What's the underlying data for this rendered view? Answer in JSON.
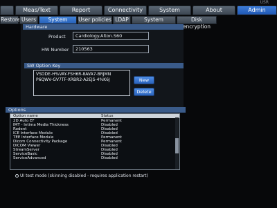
{
  "header": {
    "user": "USR"
  },
  "main_tabs": [
    "Meas/Text",
    "Report",
    "Connectivity",
    "System",
    "About",
    "Admin"
  ],
  "sub_tabs": [
    "Restore",
    "Users",
    "System Admin",
    "User policies",
    "LDAP",
    "System password",
    "Disk encryption"
  ],
  "hardware": {
    "title": "Hardware",
    "product_label": "Product",
    "product_value": "Cardiology.Alton.S60",
    "hw_number_label": "HW Number",
    "hw_number_value": "210563"
  },
  "sw_option_key": {
    "title": "SW Option Key",
    "lines": [
      "VSDDE-H%VAY-FSH6R-8AVA7-BRJMN",
      "P6QWV-GV7TF-XRBR2-A2EJS-4%K6J"
    ],
    "new_label": "New",
    "delete_label": "Delete"
  },
  "options": {
    "title": "Options",
    "col_name": "Option name",
    "col_status": "Status",
    "rows": [
      {
        "name": "2D Auto EF",
        "status": "Permanent"
      },
      {
        "name": "IMT - Intima Media Thickness",
        "status": "Disabled"
      },
      {
        "name": "Rodent",
        "status": "Disabled"
      },
      {
        "name": "ICE Interface Module",
        "status": "Disabled"
      },
      {
        "name": "TEE Interface Module",
        "status": "Permanent"
      },
      {
        "name": "Dicom Connectivity Package",
        "status": "Permanent"
      },
      {
        "name": "DICOM Viewer",
        "status": "Disabled"
      },
      {
        "name": "StreamServer",
        "status": "Disabled"
      },
      {
        "name": "ServiceBasic",
        "status": "Disabled"
      },
      {
        "name": "ServiceAdvanced",
        "status": "Disabled"
      }
    ]
  },
  "ui_test_mode_label": "UI test mode (skinning disabled - requires application restart)"
}
